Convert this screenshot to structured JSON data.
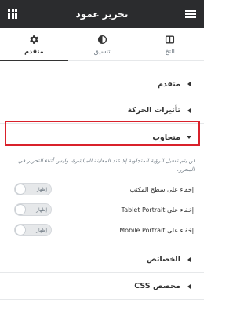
{
  "header": {
    "title": "تحرير عمود"
  },
  "tabs": [
    {
      "label": "التخ"
    },
    {
      "label": "تنسيق"
    },
    {
      "label": "متقدم"
    }
  ],
  "sections": {
    "advanced": "متقدم",
    "motion_effects": "تأثيرات الحركة",
    "responsive": "متجاوب",
    "attributes": "الخصائص",
    "custom_css": "CSS مخصص"
  },
  "responsive": {
    "note": "لن يتم تفعيل الرؤية المتجاوبة إلا عند المعاينة المباشرة، وليس أثناء التحرير في المحرر.",
    "rows": [
      {
        "label": "إخفاء على سطح المكتب",
        "toggle": "إظهار"
      },
      {
        "label": "إخفاء على Tablet Portrait",
        "toggle": "إظهار"
      },
      {
        "label": "إخفاء على Mobile Portrait",
        "toggle": "إظهار"
      }
    ]
  }
}
